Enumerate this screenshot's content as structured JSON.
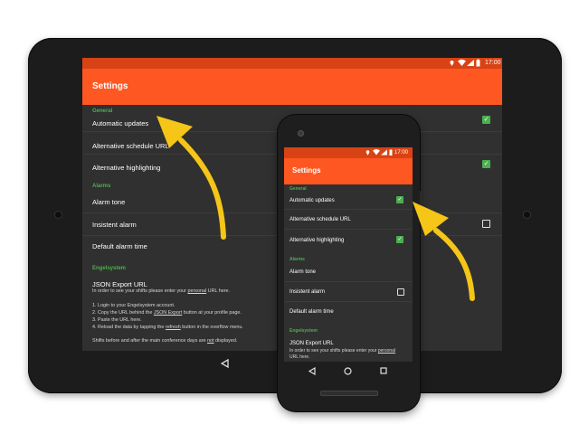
{
  "tablet": {
    "status": {
      "time": "17:00"
    },
    "app_title": "Settings",
    "sections": {
      "general": "General",
      "alarms": "Alarms",
      "engelsystem": "Engelsystem"
    },
    "items": {
      "automatic_updates": "Automatic updates",
      "alternative_schedule_url": "Alternative schedule URL",
      "alternative_highlighting": "Alternative highlighting",
      "alarm_tone": "Alarm tone",
      "insistent_alarm": "Insistent alarm",
      "default_alarm_time": "Default alarm time",
      "json_export_url": "JSON Export URL"
    },
    "summary": {
      "line1_pre": "In order to see your shifts please enter your ",
      "line1_link": "personal",
      "line1_post": " URL here.",
      "step1": "1. Login to your Engelsystem account.",
      "step2_pre": "2. Copy the URL behind the ",
      "step2_link": "JSON Export",
      "step2_post": " button at your profile page.",
      "step3": "3. Paste the URL here.",
      "step4_pre": "4. Reload the data by tapping the ",
      "step4_link": "refresh",
      "step4_post": " button in the overflow menu.",
      "footer_pre": "Shifts before and after the main conference days are ",
      "footer_link": "not",
      "footer_post": " displayed."
    },
    "checkboxes": {
      "automatic_updates": true,
      "alternative_highlighting": true,
      "insistent_alarm": false
    }
  },
  "phone": {
    "status": {
      "time": "17:00"
    },
    "app_title": "Settings",
    "sections": {
      "general": "General",
      "alarms": "Alarms",
      "engelsystem": "Engelsystem"
    },
    "items": {
      "automatic_updates": "Automatic updates",
      "alternative_schedule_url": "Alternative schedule URL",
      "alternative_highlighting": "Alternative highlighting",
      "alarm_tone": "Alarm tone",
      "insistent_alarm": "Insistent alarm",
      "default_alarm_time": "Default alarm time",
      "json_export_url": "JSON Export URL"
    },
    "summary": {
      "line1": "In order to see your shifts please enter your ",
      "line1_link": "personal",
      "line2": "URL here."
    },
    "checkboxes": {
      "automatic_updates": true,
      "alternative_highlighting": true,
      "insistent_alarm": false
    }
  },
  "colors": {
    "accent": "#ff5722",
    "status_bar": "#d84315",
    "category": "#4caf50",
    "checkbox_on": "#4caf50",
    "background": "#303030",
    "arrow": "#f5c518"
  },
  "icons": [
    "wifi-icon",
    "signal-icon",
    "battery-icon",
    "back-icon",
    "home-icon",
    "recents-icon",
    "arrow-annotation-icon"
  ]
}
